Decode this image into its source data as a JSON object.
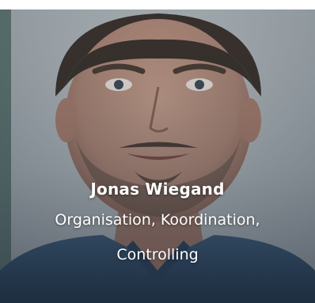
{
  "team_member": {
    "name": "Jonas Wiegand",
    "role_line1": "Organisation, Koordination,",
    "role_line2": "Controlling"
  },
  "colors": {
    "caption_text": "#ffffff",
    "photo_background": "#a9b0b4"
  },
  "icons": {
    "photo": "portrait-photo"
  }
}
